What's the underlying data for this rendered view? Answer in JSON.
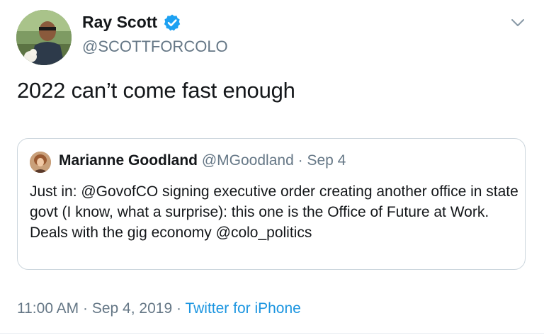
{
  "author": {
    "display_name": "Ray Scott",
    "handle": "@SCOTTFORCOLO",
    "verified": true,
    "avatar_icon": "profile-photo"
  },
  "menu_icon": "chevron-down-icon",
  "tweet": {
    "text": "2022 can’t come fast enough"
  },
  "quoted_tweet": {
    "display_name": "Marianne Goodland",
    "handle": "@MGoodland",
    "separator": "·",
    "date": "Sep 4",
    "text": "Just in: @GovofCO signing executive order creating another office in state govt (I know, what a surprise): this one is the Office of Future at Work. Deals with the gig economy @colo_politics"
  },
  "footer": {
    "time": "11:00 AM",
    "separator": "·",
    "date": "Sep 4, 2019",
    "source": "Twitter for iPhone"
  },
  "colors": {
    "text": "#14171a",
    "secondary": "#657786",
    "link": "#1b95e0",
    "verified": "#1da1f2",
    "border": "#ccd6dd"
  }
}
